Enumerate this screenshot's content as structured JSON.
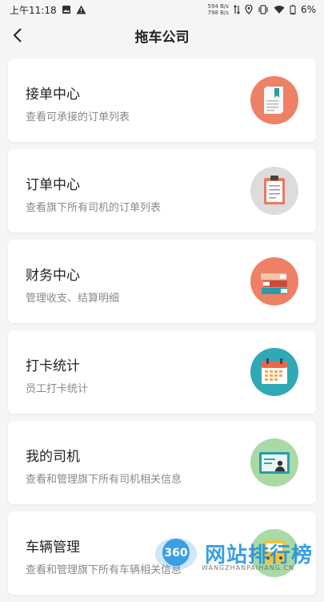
{
  "status_bar": {
    "time": "上午11:18",
    "net_speed_up": "594 B/s",
    "net_speed_down": "798 B/s",
    "battery": "6%"
  },
  "header": {
    "title": "拖车公司"
  },
  "cards": [
    {
      "title": "接单中心",
      "subtitle": "查看可承接的订单列表",
      "icon": "document-icon",
      "color": "#ee8065"
    },
    {
      "title": "订单中心",
      "subtitle": "查看旗下所有司机的订单列表",
      "icon": "clipboard-icon",
      "color": "#dcdcdc"
    },
    {
      "title": "财务中心",
      "subtitle": "管理收支、结算明细",
      "icon": "books-icon",
      "color": "#ee8065"
    },
    {
      "title": "打卡统计",
      "subtitle": "员工打卡统计",
      "icon": "calendar-icon",
      "color": "#30a8b5"
    },
    {
      "title": "我的司机",
      "subtitle": "查看和管理旗下所有司机相关信息",
      "icon": "id-card-icon",
      "color": "#a9d9a5"
    },
    {
      "title": "车辆管理",
      "subtitle": "查看和管理旗下所有车辆相关信息",
      "icon": "bus-icon",
      "color": "#a9d9a5"
    }
  ],
  "watermark": {
    "badge": "360",
    "text": "网站排行榜",
    "sub": "WANGZHANPAIHANG.CN"
  }
}
